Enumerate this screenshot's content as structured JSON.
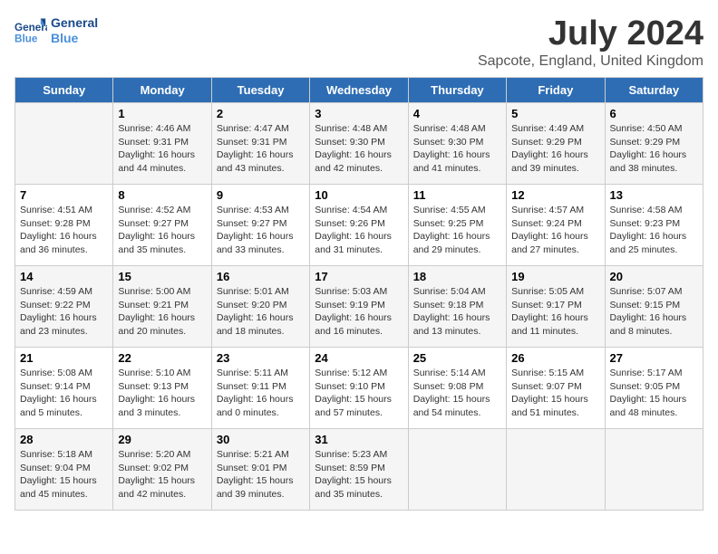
{
  "header": {
    "logo_line1": "General",
    "logo_line2": "Blue",
    "title": "July 2024",
    "subtitle": "Sapcote, England, United Kingdom"
  },
  "days_of_week": [
    "Sunday",
    "Monday",
    "Tuesday",
    "Wednesday",
    "Thursday",
    "Friday",
    "Saturday"
  ],
  "weeks": [
    [
      {
        "day": "",
        "info": ""
      },
      {
        "day": "1",
        "info": "Sunrise: 4:46 AM\nSunset: 9:31 PM\nDaylight: 16 hours\nand 44 minutes."
      },
      {
        "day": "2",
        "info": "Sunrise: 4:47 AM\nSunset: 9:31 PM\nDaylight: 16 hours\nand 43 minutes."
      },
      {
        "day": "3",
        "info": "Sunrise: 4:48 AM\nSunset: 9:30 PM\nDaylight: 16 hours\nand 42 minutes."
      },
      {
        "day": "4",
        "info": "Sunrise: 4:48 AM\nSunset: 9:30 PM\nDaylight: 16 hours\nand 41 minutes."
      },
      {
        "day": "5",
        "info": "Sunrise: 4:49 AM\nSunset: 9:29 PM\nDaylight: 16 hours\nand 39 minutes."
      },
      {
        "day": "6",
        "info": "Sunrise: 4:50 AM\nSunset: 9:29 PM\nDaylight: 16 hours\nand 38 minutes."
      }
    ],
    [
      {
        "day": "7",
        "info": "Sunrise: 4:51 AM\nSunset: 9:28 PM\nDaylight: 16 hours\nand 36 minutes."
      },
      {
        "day": "8",
        "info": "Sunrise: 4:52 AM\nSunset: 9:27 PM\nDaylight: 16 hours\nand 35 minutes."
      },
      {
        "day": "9",
        "info": "Sunrise: 4:53 AM\nSunset: 9:27 PM\nDaylight: 16 hours\nand 33 minutes."
      },
      {
        "day": "10",
        "info": "Sunrise: 4:54 AM\nSunset: 9:26 PM\nDaylight: 16 hours\nand 31 minutes."
      },
      {
        "day": "11",
        "info": "Sunrise: 4:55 AM\nSunset: 9:25 PM\nDaylight: 16 hours\nand 29 minutes."
      },
      {
        "day": "12",
        "info": "Sunrise: 4:57 AM\nSunset: 9:24 PM\nDaylight: 16 hours\nand 27 minutes."
      },
      {
        "day": "13",
        "info": "Sunrise: 4:58 AM\nSunset: 9:23 PM\nDaylight: 16 hours\nand 25 minutes."
      }
    ],
    [
      {
        "day": "14",
        "info": "Sunrise: 4:59 AM\nSunset: 9:22 PM\nDaylight: 16 hours\nand 23 minutes."
      },
      {
        "day": "15",
        "info": "Sunrise: 5:00 AM\nSunset: 9:21 PM\nDaylight: 16 hours\nand 20 minutes."
      },
      {
        "day": "16",
        "info": "Sunrise: 5:01 AM\nSunset: 9:20 PM\nDaylight: 16 hours\nand 18 minutes."
      },
      {
        "day": "17",
        "info": "Sunrise: 5:03 AM\nSunset: 9:19 PM\nDaylight: 16 hours\nand 16 minutes."
      },
      {
        "day": "18",
        "info": "Sunrise: 5:04 AM\nSunset: 9:18 PM\nDaylight: 16 hours\nand 13 minutes."
      },
      {
        "day": "19",
        "info": "Sunrise: 5:05 AM\nSunset: 9:17 PM\nDaylight: 16 hours\nand 11 minutes."
      },
      {
        "day": "20",
        "info": "Sunrise: 5:07 AM\nSunset: 9:15 PM\nDaylight: 16 hours\nand 8 minutes."
      }
    ],
    [
      {
        "day": "21",
        "info": "Sunrise: 5:08 AM\nSunset: 9:14 PM\nDaylight: 16 hours\nand 5 minutes."
      },
      {
        "day": "22",
        "info": "Sunrise: 5:10 AM\nSunset: 9:13 PM\nDaylight: 16 hours\nand 3 minutes."
      },
      {
        "day": "23",
        "info": "Sunrise: 5:11 AM\nSunset: 9:11 PM\nDaylight: 16 hours\nand 0 minutes."
      },
      {
        "day": "24",
        "info": "Sunrise: 5:12 AM\nSunset: 9:10 PM\nDaylight: 15 hours\nand 57 minutes."
      },
      {
        "day": "25",
        "info": "Sunrise: 5:14 AM\nSunset: 9:08 PM\nDaylight: 15 hours\nand 54 minutes."
      },
      {
        "day": "26",
        "info": "Sunrise: 5:15 AM\nSunset: 9:07 PM\nDaylight: 15 hours\nand 51 minutes."
      },
      {
        "day": "27",
        "info": "Sunrise: 5:17 AM\nSunset: 9:05 PM\nDaylight: 15 hours\nand 48 minutes."
      }
    ],
    [
      {
        "day": "28",
        "info": "Sunrise: 5:18 AM\nSunset: 9:04 PM\nDaylight: 15 hours\nand 45 minutes."
      },
      {
        "day": "29",
        "info": "Sunrise: 5:20 AM\nSunset: 9:02 PM\nDaylight: 15 hours\nand 42 minutes."
      },
      {
        "day": "30",
        "info": "Sunrise: 5:21 AM\nSunset: 9:01 PM\nDaylight: 15 hours\nand 39 minutes."
      },
      {
        "day": "31",
        "info": "Sunrise: 5:23 AM\nSunset: 8:59 PM\nDaylight: 15 hours\nand 35 minutes."
      },
      {
        "day": "",
        "info": ""
      },
      {
        "day": "",
        "info": ""
      },
      {
        "day": "",
        "info": ""
      }
    ]
  ]
}
